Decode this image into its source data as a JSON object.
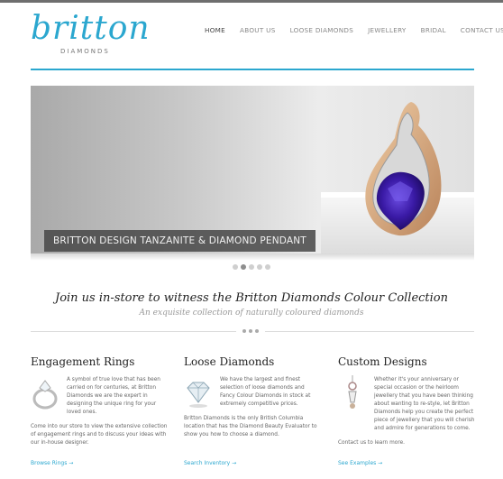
{
  "logo": {
    "word": "britton",
    "sub": "DIAMONDS"
  },
  "nav": [
    {
      "label": "HOME",
      "active": true
    },
    {
      "label": "ABOUT US",
      "active": false
    },
    {
      "label": "LOOSE DIAMONDS",
      "active": false
    },
    {
      "label": "JEWELLERY",
      "active": false
    },
    {
      "label": "BRIDAL",
      "active": false
    },
    {
      "label": "CONTACT US",
      "active": false
    }
  ],
  "hero": {
    "caption": "BRITTON DESIGN TANZANITE & DIAMOND PENDANT",
    "slides": 5,
    "active_slide": 2
  },
  "tagline": "Join us in-store to witness the Britton Diamonds Colour Collection",
  "subtagline": "An exquisite collection of naturally coloured diamonds",
  "columns": [
    {
      "title": "Engagement Rings",
      "icon": "ring-icon",
      "intro": "A symbol of true love that has been carried on for centuries, at Britton Diamonds we are the expert in designing the unique ring for your loved ones.",
      "more": "Come into our store to view the extensive collection of engagement rings and to discuss your ideas with our in-house designer.",
      "link": "Browse Rings →"
    },
    {
      "title": "Loose Diamonds",
      "icon": "diamond-icon",
      "intro": "We have the largest and finest selection of loose diamonds and Fancy Colour Diamonds in stock at extremely competitive prices.",
      "more": "Britton Diamonds is the only British Columbia location that has the Diamond Beauty Evaluator to show you how to choose a diamond.",
      "link": "Search Inventory →"
    },
    {
      "title": "Custom Designs",
      "icon": "pendant-icon",
      "intro": "Whether it's your anniversary or special occasion or the heirloom jewellery that you have been thinking about wanting to re-style, let Britton Diamonds help you create the perfect piece of jewellery that you will cherish and admire for generations to come.",
      "more": "Contact us to learn more.",
      "link": "See Examples →"
    }
  ],
  "colors": {
    "accent": "#2ba7cf",
    "gem": "#3a1aa6",
    "gold": "#d9a77a"
  }
}
